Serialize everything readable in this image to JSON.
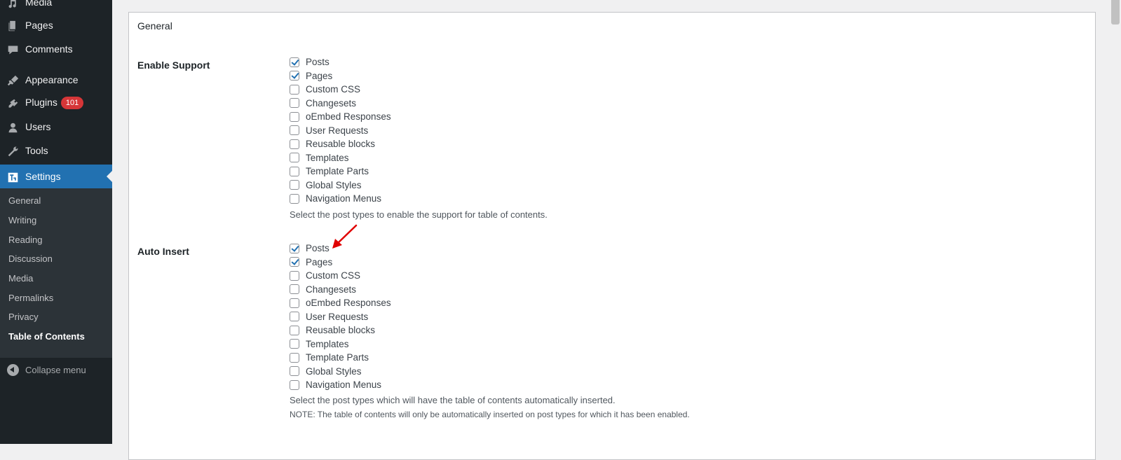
{
  "sidebar": {
    "items": [
      {
        "label": "Media",
        "icon": "media-icon"
      },
      {
        "label": "Pages",
        "icon": "pages-icon"
      },
      {
        "label": "Comments",
        "icon": "comments-icon"
      },
      {
        "label": "Appearance",
        "icon": "appearance-icon"
      },
      {
        "label": "Plugins",
        "icon": "plugins-icon",
        "badge": "101"
      },
      {
        "label": "Users",
        "icon": "users-icon"
      },
      {
        "label": "Tools",
        "icon": "tools-icon"
      },
      {
        "label": "Settings",
        "icon": "settings-icon",
        "current": true
      }
    ],
    "submenu": [
      "General",
      "Writing",
      "Reading",
      "Discussion",
      "Media",
      "Permalinks",
      "Privacy",
      "Table of Contents"
    ],
    "submenu_current": "Table of Contents",
    "collapse_label": "Collapse menu"
  },
  "panel": {
    "title": "General",
    "enable_support": {
      "label": "Enable Support",
      "options": [
        {
          "label": "Posts",
          "checked": true
        },
        {
          "label": "Pages",
          "checked": true
        },
        {
          "label": "Custom CSS",
          "checked": false
        },
        {
          "label": "Changesets",
          "checked": false
        },
        {
          "label": "oEmbed Responses",
          "checked": false
        },
        {
          "label": "User Requests",
          "checked": false
        },
        {
          "label": "Reusable blocks",
          "checked": false
        },
        {
          "label": "Templates",
          "checked": false
        },
        {
          "label": "Template Parts",
          "checked": false
        },
        {
          "label": "Global Styles",
          "checked": false
        },
        {
          "label": "Navigation Menus",
          "checked": false
        }
      ],
      "description": "Select the post types to enable the support for table of contents."
    },
    "auto_insert": {
      "label": "Auto Insert",
      "options": [
        {
          "label": "Posts",
          "checked": true
        },
        {
          "label": "Pages",
          "checked": true
        },
        {
          "label": "Custom CSS",
          "checked": false
        },
        {
          "label": "Changesets",
          "checked": false
        },
        {
          "label": "oEmbed Responses",
          "checked": false
        },
        {
          "label": "User Requests",
          "checked": false
        },
        {
          "label": "Reusable blocks",
          "checked": false
        },
        {
          "label": "Templates",
          "checked": false
        },
        {
          "label": "Template Parts",
          "checked": false
        },
        {
          "label": "Global Styles",
          "checked": false
        },
        {
          "label": "Navigation Menus",
          "checked": false
        }
      ],
      "description": "Select the post types which will have the table of contents automatically inserted.",
      "note": "NOTE: The table of contents will only be automatically inserted on post types for which it has been enabled."
    }
  },
  "colors": {
    "sidebar_bg": "#1d2327",
    "submenu_bg": "#2c3338",
    "accent": "#2271b1",
    "badge": "#d63638",
    "annotation_arrow": "#e00000"
  }
}
